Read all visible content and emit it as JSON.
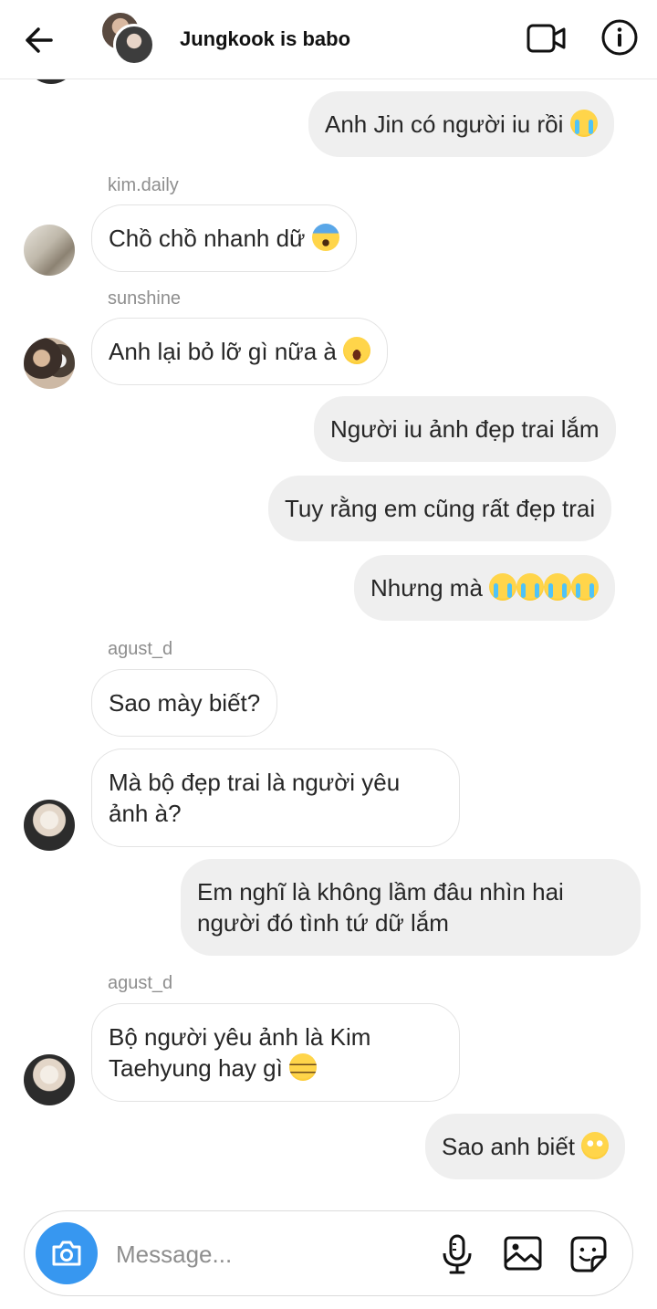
{
  "header": {
    "title": "Jungkook is babo"
  },
  "messages": [
    {
      "dir": "out",
      "text": "Anh Jin có người iu rồi",
      "emoji": "loudly-crying-face"
    },
    {
      "dir": "in",
      "sender": "kim.daily",
      "text": "Chồ chồ nhanh dữ",
      "emoji": "face-screaming-in-fear"
    },
    {
      "dir": "in",
      "sender": "sunshine",
      "text": "Anh lại bỏ lỡ gì nữa à",
      "emoji": "grinning-face"
    },
    {
      "dir": "out",
      "text": "Người iu ảnh đẹp trai lắm"
    },
    {
      "dir": "out",
      "text": "Tuy rằng em cũng rất đẹp trai"
    },
    {
      "dir": "out",
      "text": "Nhưng mà",
      "emoji": "loudly-crying-face x4"
    },
    {
      "dir": "in",
      "sender": "agust_d",
      "text": "Sao mày biết?"
    },
    {
      "dir": "in",
      "text_line1": "Mà bộ đẹp trai là người yêu",
      "text_line2": "ảnh à?"
    },
    {
      "dir": "out",
      "text_line1": "Em nghĩ là không lầm đâu nhìn hai",
      "text_line2": "người đó tình tứ dữ lắm"
    },
    {
      "dir": "in",
      "sender": "agust_d",
      "text_line1": "Bộ người yêu ảnh là Kim",
      "text_line2": "Taehyung hay gì",
      "emoji": "unamused-face"
    },
    {
      "dir": "out",
      "text": "Sao anh biết",
      "emoji": "flushed-face"
    }
  ],
  "composer": {
    "placeholder": "Message..."
  },
  "icons": {
    "back": "back-arrow-icon",
    "video": "video-call-icon",
    "info": "info-icon",
    "camera": "camera-icon",
    "mic": "microphone-icon",
    "gallery": "gallery-icon",
    "sticker": "sticker-icon"
  },
  "colors": {
    "accent": "#3797f0",
    "outgoing_bubble": "#efefef",
    "incoming_border": "#e3e3e3",
    "sender_name": "#8e8e8e"
  }
}
